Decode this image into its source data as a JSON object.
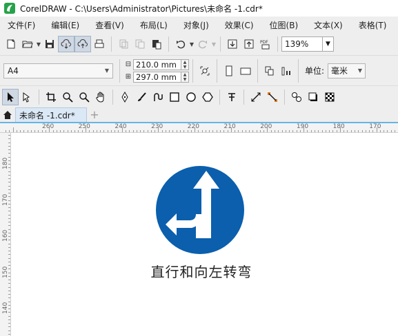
{
  "window": {
    "title": "CorelDRAW - C:\\Users\\Administrator\\Pictures\\未命名 -1.cdr*"
  },
  "menu": [
    {
      "id": "file",
      "label": "文件(F)"
    },
    {
      "id": "edit",
      "label": "编辑(E)"
    },
    {
      "id": "view",
      "label": "查看(V)"
    },
    {
      "id": "layout",
      "label": "布局(L)"
    },
    {
      "id": "object",
      "label": "对象(J)"
    },
    {
      "id": "effects",
      "label": "效果(C)"
    },
    {
      "id": "bitmaps",
      "label": "位图(B)"
    },
    {
      "id": "text",
      "label": "文本(X)"
    },
    {
      "id": "table",
      "label": "表格(T)"
    }
  ],
  "toolbar": {
    "zoom_value": "139%",
    "pdf_label": "PDF"
  },
  "property_bar": {
    "page_size": "A4",
    "width": "210.0 mm",
    "height": "297.0 mm",
    "unit_label": "单位:",
    "unit_value": "毫米"
  },
  "tabs": {
    "document_tab": "未命名 -1.cdr*"
  },
  "ruler": {
    "horizontal": [
      "260",
      "250",
      "240",
      "230",
      "220",
      "210",
      "200",
      "190",
      "180",
      "170"
    ],
    "vertical": [
      "180",
      "170",
      "160",
      "150",
      "140"
    ]
  },
  "canvas": {
    "sign_color": "#0b5fad",
    "caption": "直行和向左转弯"
  },
  "colors": {
    "app_logo": "#26a34a",
    "ruler_highlight": "#64b5e8"
  }
}
